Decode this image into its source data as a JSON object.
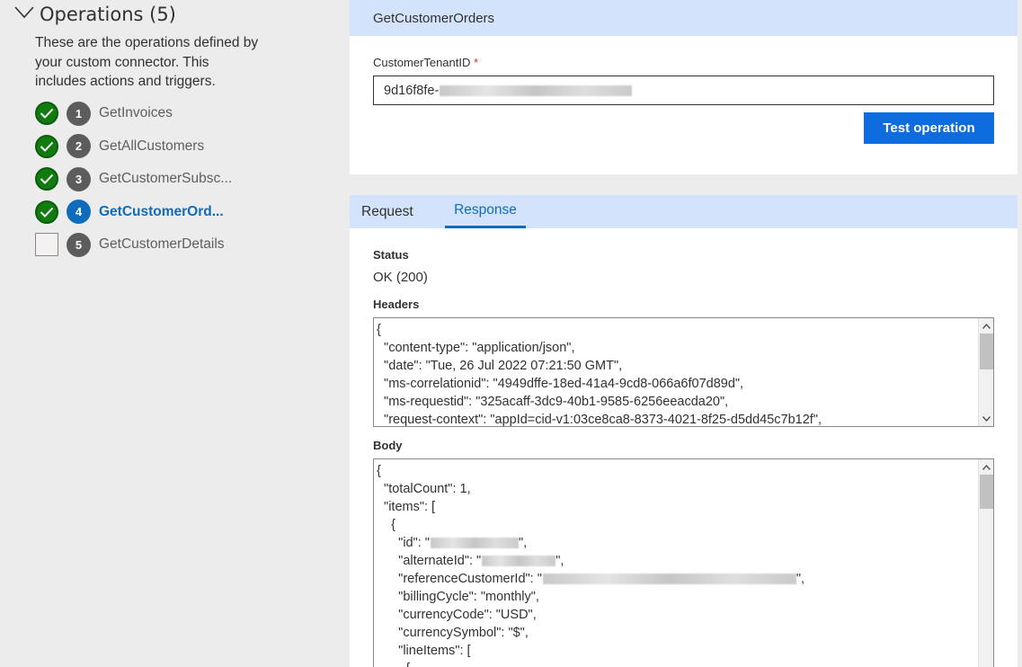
{
  "operations": {
    "title": "Operations (5)",
    "description": "These are the operations defined by your custom connector. This includes actions and triggers.",
    "items": [
      {
        "num": "1",
        "label": "GetInvoices",
        "checked": true,
        "active": false
      },
      {
        "num": "2",
        "label": "GetAllCustomers",
        "checked": true,
        "active": false
      },
      {
        "num": "3",
        "label": "GetCustomerSubsc...",
        "checked": true,
        "active": false
      },
      {
        "num": "4",
        "label": "GetCustomerOrd...",
        "checked": true,
        "active": true
      },
      {
        "num": "5",
        "label": "GetCustomerDetails",
        "checked": false,
        "active": false
      }
    ]
  },
  "operation_card": {
    "title": "GetCustomerOrders",
    "field_label": "CustomerTenantID",
    "required_mark": "*",
    "tenant_value": "9d16f8fe-",
    "test_button": "Test operation"
  },
  "response_card": {
    "tabs": [
      "Request",
      "Response"
    ],
    "selected_tab": "Response",
    "status_label": "Status",
    "status_value": "OK (200)",
    "headers_label": "Headers",
    "headers_lines": [
      "{",
      "  \"content-type\": \"application/json\",",
      "  \"date\": \"Tue, 26 Jul 2022 07:21:50 GMT\",",
      "  \"ms-correlationid\": \"4949dffe-18ed-41a4-9cd8-066a6f07d89d\",",
      "  \"ms-requestid\": \"325acaff-3dc9-40b1-9585-6256eeacda20\",",
      "  \"request-context\": \"appId=cid-v1:03ce8ca8-8373-4021-8f25-d5dd45c7b12f\","
    ],
    "body_label": "Body",
    "body_lines": [
      "{",
      "  \"totalCount\": 1,",
      "  \"items\": [",
      "    {",
      "      \"id\": \"",
      "      \"alternateId\": \"",
      "      \"referenceCustomerId\": \"",
      "      \"billingCycle\": \"monthly\",",
      "      \"currencyCode\": \"USD\",",
      "      \"currencySymbol\": \"$\",",
      "      \"lineItems\": [",
      "        {"
    ],
    "body_line_suffixes": [
      "",
      "",
      "",
      "",
      "\",",
      "\",",
      "\",",
      "",
      "",
      "",
      "",
      ""
    ]
  },
  "colors": {
    "accent": "#0f6cbd",
    "success": "#107c10",
    "header_band": "#d4e3fc",
    "required": "#d13438"
  }
}
